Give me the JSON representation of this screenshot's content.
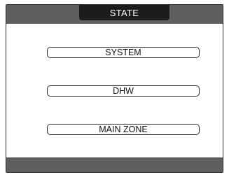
{
  "header": {
    "title": "STATE"
  },
  "menu": {
    "items": [
      {
        "label": "SYSTEM"
      },
      {
        "label": "DHW"
      },
      {
        "label": "MAIN ZONE"
      }
    ]
  },
  "colors": {
    "bar": "#5f5f5f",
    "title_tab": "#1c1c1c",
    "border": "#2b2b2b"
  }
}
